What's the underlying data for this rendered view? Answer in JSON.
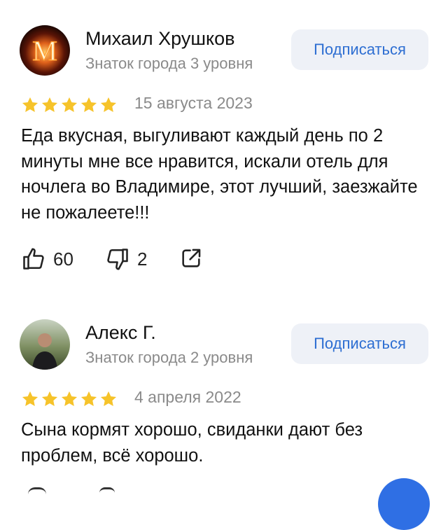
{
  "reviews": [
    {
      "author": "Михаил Хрушков",
      "level": "Знаток города 3 уровня",
      "avatar_letter": "M",
      "subscribe_label": "Подписаться",
      "rating": 5,
      "date": "15 августа 2023",
      "text": "Еда вкусная, выгуливают каждый день по 2 минуты мне все нравится, искали отель для ночлега во Владимире, этот лучший, заезжайте не пожалеете!!!",
      "likes": "60",
      "dislikes": "2"
    },
    {
      "author": "Алекс Г.",
      "level": "Знаток города 2 уровня",
      "subscribe_label": "Подписаться",
      "rating": 5,
      "date": "4 апреля 2022",
      "text": "Сына кормят хорошо, свиданки дают без проблем, всё хорошо."
    }
  ],
  "icons": {
    "star": "star-icon",
    "like": "thumb-up-icon",
    "dislike": "thumb-down-icon",
    "share": "share-icon"
  },
  "colors": {
    "accent": "#2d6ed2",
    "star": "#f6c32a",
    "subscribe_bg": "#eef1f7",
    "muted": "#8a8a8a"
  }
}
